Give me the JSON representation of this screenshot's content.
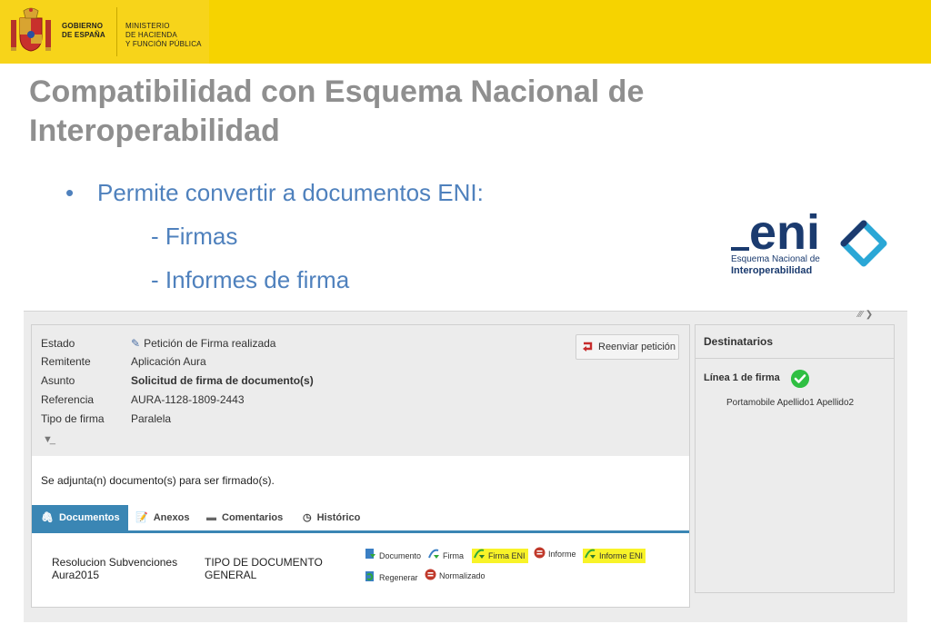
{
  "header": {
    "gov_line1": "GOBIERNO",
    "gov_line2": "DE ESPAÑA",
    "min_line1": "MINISTERIO",
    "min_line2": "DE HACIENDA",
    "min_line3": "Y FUNCIÓN PÚBLICA",
    "bar_color": "#f6d300"
  },
  "slide": {
    "title_line1": "Compatibilidad con Esquema Nacional de",
    "title_line2": "Interoperabilidad",
    "bullet": "Permite convertir a documentos ENI:",
    "sub1": "- Firmas",
    "sub2": "- Informes de firma",
    "bullet_symbol": "•",
    "text_color": "#4f81bd"
  },
  "eni_logo": {
    "word": "eni",
    "line1": "Esquema Nacional de",
    "line2": "Interoperabilidad"
  },
  "request": {
    "labels": {
      "estado": "Estado",
      "remitente": "Remitente",
      "asunto": "Asunto",
      "referencia": "Referencia",
      "tipo_firma": "Tipo de firma"
    },
    "values": {
      "estado": "Petición de Firma realizada",
      "remitente": "Aplicación Aura",
      "asunto": "Solicitud de firma de documento(s)",
      "referencia": "AURA-1128-1809-2443",
      "tipo_firma": "Paralela"
    },
    "resend_label": "Reenviar petición",
    "message": "Se adjunta(n) documento(s) para ser firmado(s)."
  },
  "tabs": [
    {
      "label": "Documentos",
      "icon": "paperclip-icon",
      "active": true
    },
    {
      "label": "Anexos",
      "icon": "attachment-doc-icon",
      "active": false
    },
    {
      "label": "Comentarios",
      "icon": "comment-icon",
      "active": false
    },
    {
      "label": "Histórico",
      "icon": "history-icon",
      "active": false
    }
  ],
  "document_row": {
    "name_line1": "Resolucion Subvenciones",
    "name_line2": "Aura2015",
    "type_line1": "TIPO DE DOCUMENTO",
    "type_line2": "GENERAL",
    "actions": [
      {
        "label": "Documento",
        "highlighted": false
      },
      {
        "label": "Firma",
        "highlighted": false
      },
      {
        "label": "Firma ENI",
        "highlighted": true
      },
      {
        "label": "Informe",
        "highlighted": false
      },
      {
        "label": "Informe ENI",
        "highlighted": true
      },
      {
        "label": "Regenerar",
        "highlighted": false
      },
      {
        "label": "Normalizado",
        "highlighted": false
      }
    ],
    "highlight_color": "#f8f328"
  },
  "recipients": {
    "title": "Destinatarios",
    "line_title": "Línea 1 de firma",
    "signer": "Portamobile Apellido1 Apellido2",
    "status_color": "#2fbf42"
  }
}
